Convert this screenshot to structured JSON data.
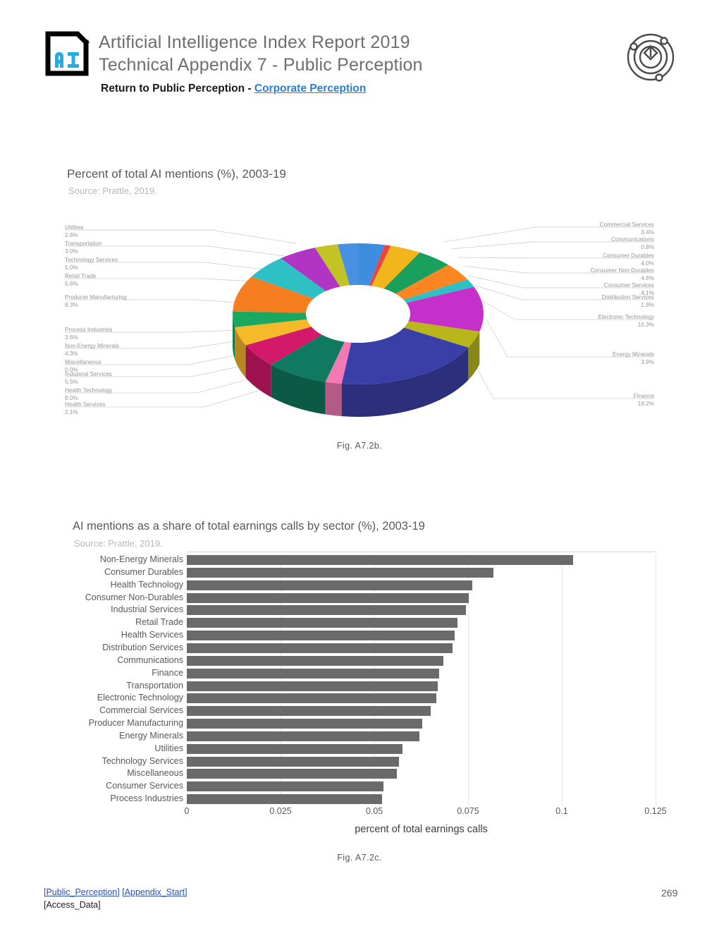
{
  "header": {
    "logo_text": "AI",
    "title_line1": "Artificial Intelligence Index Report 2019",
    "title_line2": "Technical Appendix 7 - Public Perception",
    "subnav_prefix": "Return to Public Perception - ",
    "subnav_link": "Corporate Perception",
    "right_icon": "atom-orbit-icon"
  },
  "figure1": {
    "title": "Percent of total AI mentions (%), 2003-19",
    "source": "Source: Prattle, 2019.",
    "caption": "Fig. A7.2b."
  },
  "figure2": {
    "title": "AI mentions as a share of total earnings calls by sector (%), 2003-19",
    "source": "Source: Prattle, 2019.",
    "caption": "Fig. A7.2c.",
    "xaxis_label": "percent of total earnings calls"
  },
  "footer": {
    "link1": "[Public_Perception]",
    "link2": "[Appendix_Start]",
    "link3": "[Access_Data]",
    "page_number": "269"
  },
  "chart_data": [
    {
      "type": "pie",
      "title": "Percent of total AI mentions (%), 2003-19",
      "subtitle": "Source: Prattle, 2019.",
      "unit": "%",
      "legend": "callout-labels",
      "labels": [
        "Commercial Services",
        "Communications",
        "Consumer Durables",
        "Consumer Non-Durables",
        "Consumer Services",
        "Distribution Services",
        "Electronic Technology",
        "Energy Minerals",
        "Finance",
        "Health Services",
        "Health Technology",
        "Industrial Services",
        "Miscellaneous",
        "Non-Energy Minerals",
        "Process Industries",
        "Producer Manufacturing",
        "Retail Trade",
        "Technology Services",
        "Transportation",
        "Utilities"
      ],
      "values": [
        3.4,
        0.8,
        4.0,
        4.6,
        4.1,
        1.9,
        10.3,
        3.9,
        19.2,
        2.1,
        8.0,
        5.5,
        0.0,
        4.3,
        3.6,
        8.3,
        5.6,
        5.0,
        3.0,
        2.6
      ],
      "value_labels": [
        "3.4%",
        "0.8%",
        "4.0%",
        "4.6%",
        "4.1%",
        "1.9%",
        "10.3%",
        "3.9%",
        "19.2%",
        "2.1%",
        "8.0%",
        "5.5%",
        "0.0%",
        "4.3%",
        "3.6%",
        "8.3%",
        "5.6%",
        "5.0%",
        "3.0%",
        "2.6%"
      ],
      "colors": [
        "#3d8ede",
        "#e8473f",
        "#f2b61c",
        "#18a05c",
        "#fa8521",
        "#2dc0c5",
        "#c430c9",
        "#b9b61c",
        "#3a3fa8",
        "#f27ab4",
        "#0f7a5f",
        "#d4186a",
        "#ef6a4c",
        "#f5b92a",
        "#1aa860",
        "#f77e20",
        "#2dc0c5",
        "#b234c4",
        "#c2c425",
        "#4a90e2"
      ],
      "callouts_left": [
        {
          "name": "Utilities",
          "value": "2.6%"
        },
        {
          "name": "Transportation",
          "value": "3.0%"
        },
        {
          "name": "Technology Services",
          "value": "5.0%"
        },
        {
          "name": "Retail Trade",
          "value": "5.6%"
        },
        {
          "name": "Producer Manufacturing",
          "value": "8.3%"
        },
        {
          "name": "Process Industries",
          "value": "3.6%"
        },
        {
          "name": "Non-Energy Minerals",
          "value": "4.3%"
        },
        {
          "name": "Miscellaneous",
          "value": "0.0%"
        },
        {
          "name": "Industrial Services",
          "value": "5.5%"
        },
        {
          "name": "Health Technology",
          "value": "8.0%"
        },
        {
          "name": "Health Services",
          "value": "2.1%"
        }
      ],
      "callouts_right": [
        {
          "name": "Commercial Services",
          "value": "3.4%"
        },
        {
          "name": "Communications",
          "value": "0.8%"
        },
        {
          "name": "Consumer Durables",
          "value": "4.0%"
        },
        {
          "name": "Consumer Non-Durables",
          "value": "4.6%"
        },
        {
          "name": "Consumer Services",
          "value": "4.1%"
        },
        {
          "name": "Distribution Services",
          "value": "1.9%"
        },
        {
          "name": "Electronic Technology",
          "value": "10.3%"
        },
        {
          "name": "Energy Minerals",
          "value": "3.9%"
        },
        {
          "name": "Finance",
          "value": "19.2%"
        }
      ]
    },
    {
      "type": "bar",
      "orientation": "horizontal",
      "title": "AI mentions as a share of total earnings calls by sector (%), 2003-19",
      "subtitle": "Source: Prattle, 2019.",
      "xlabel": "percent of total earnings calls",
      "ylabel": "",
      "xlim": [
        0,
        0.125
      ],
      "xticks": [
        0,
        0.025,
        0.05,
        0.075,
        0.1,
        0.125
      ],
      "xtick_labels": [
        "0",
        "0.025",
        "0.05",
        "0.075",
        "0.1",
        "0.125"
      ],
      "grid": true,
      "bar_color": "#6a6a6a",
      "categories": [
        "Non-Energy Minerals",
        "Consumer Durables",
        "Health Technology",
        "Consumer Non-Durables",
        "Industrial Services",
        "Retail Trade",
        "Health Services",
        "Distribution Services",
        "Communications",
        "Finance",
        "Transportation",
        "Electronic Technology",
        "Commercial Services",
        "Producer Manufacturing",
        "Energy Minerals",
        "Utilities",
        "Technology Services",
        "Miscellaneous",
        "Consumer Services",
        "Process Industries"
      ],
      "values": [
        0.103,
        0.0818,
        0.0761,
        0.0752,
        0.0745,
        0.0722,
        0.0714,
        0.0708,
        0.0685,
        0.0673,
        0.067,
        0.0665,
        0.065,
        0.0628,
        0.062,
        0.0575,
        0.0565,
        0.056,
        0.0525,
        0.052
      ]
    }
  ]
}
